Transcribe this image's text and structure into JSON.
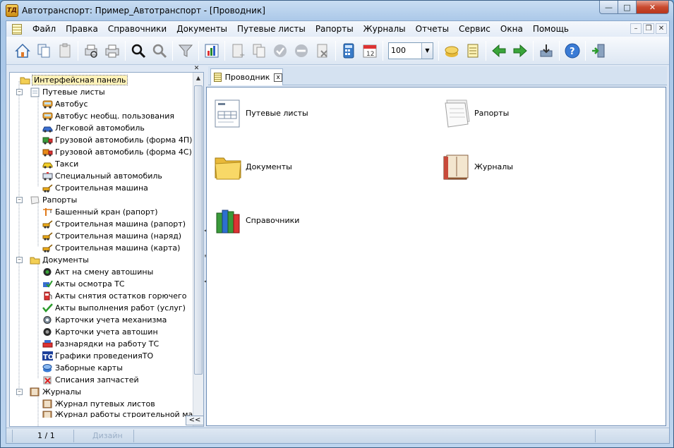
{
  "window": {
    "title": "Автотранспорт: Пример_Автотранспорт - [Проводник]",
    "app_icon_text": "ТД",
    "controls": [
      "minimize",
      "maximize",
      "close"
    ]
  },
  "menu": {
    "items": [
      "Файл",
      "Правка",
      "Справочники",
      "Документы",
      "Путевые листы",
      "Рапорты",
      "Журналы",
      "Отчеты",
      "Сервис",
      "Окна",
      "Помощь"
    ],
    "mdi_controls": [
      "minimize",
      "restore",
      "close"
    ]
  },
  "toolbar": {
    "zoom_value": "100",
    "icons": [
      "home-icon",
      "copy-docs-icon",
      "paste-icon",
      "print-preview-icon",
      "print-icon",
      "search-icon",
      "search-gray-icon",
      "filter-icon",
      "chart-icon",
      "new-doc-icon",
      "copy-doc-icon",
      "check-icon",
      "minus-icon",
      "delete-doc-icon",
      "calculator-icon",
      "calendar-icon",
      "notes-icon",
      "document-icon",
      "back-arrow-icon",
      "forward-arrow-icon",
      "transfer-icon",
      "help-icon",
      "exit-icon"
    ]
  },
  "tree": {
    "root": "Интерфейсная панель",
    "groups": [
      {
        "label": "Путевые листы",
        "items": [
          "Автобус",
          "Автобус необщ. пользования",
          "Легковой автомобиль",
          "Грузовой автомобиль (форма 4П)",
          "Грузовой автомобиль (форма 4С)",
          "Такси",
          "Специальный автомобиль",
          "Строительная машина"
        ]
      },
      {
        "label": "Рапорты",
        "items": [
          "Башенный кран (рапорт)",
          "Строительная машина (рапорт)",
          "Строительная машина (наряд)",
          "Строительная машина (карта)"
        ]
      },
      {
        "label": "Документы",
        "items": [
          "Акт на смену автошины",
          "Акты осмотра ТС",
          "Акты снятия остатков горючего",
          "Акты выполнения работ (услуг)",
          "Карточки учета механизма",
          "Карточки учета автошин",
          "Разнарядки на работу ТС",
          "Графики проведенияТО",
          "Заборные карты",
          "Списания запчастей"
        ]
      },
      {
        "label": "Журналы",
        "items": [
          "Журнал путевых листов",
          "Журнал работы строительной машины"
        ]
      }
    ],
    "collapse_label": "<<"
  },
  "tab": {
    "label": "Проводник",
    "close": "x"
  },
  "explorer": {
    "items": [
      {
        "label": "Путевые листы",
        "icon": "waybill-form-icon"
      },
      {
        "label": "Рапорты",
        "icon": "report-pages-icon"
      },
      {
        "label": "Документы",
        "icon": "folder-icon"
      },
      {
        "label": "Журналы",
        "icon": "journal-book-icon"
      },
      {
        "label": "Справочники",
        "icon": "reference-books-icon"
      }
    ]
  },
  "status": {
    "page": "1 / 1",
    "mode": "Дизайн"
  }
}
